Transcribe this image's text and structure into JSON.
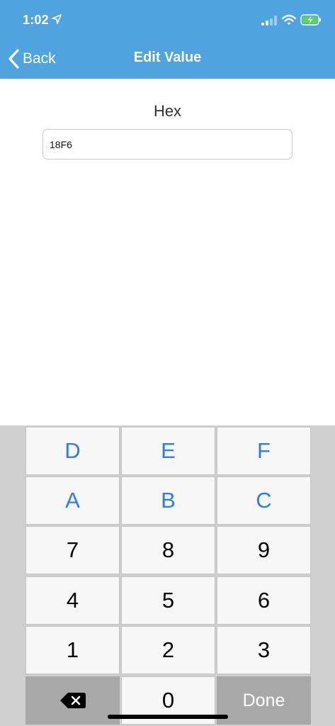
{
  "status_bar": {
    "time": "1:02",
    "icons": [
      "location-arrow-icon",
      "cellular-signal-icon",
      "wifi-icon",
      "battery-charging-icon"
    ]
  },
  "nav": {
    "back_label": "Back",
    "title": "Edit Value"
  },
  "field": {
    "label": "Hex",
    "value": "18F6"
  },
  "keypad": {
    "rows": [
      [
        "D",
        "E",
        "F"
      ],
      [
        "A",
        "B",
        "C"
      ],
      [
        "7",
        "8",
        "9"
      ],
      [
        "4",
        "5",
        "6"
      ],
      [
        "1",
        "2",
        "3"
      ]
    ],
    "zero": "0",
    "done_label": "Done",
    "delete_icon": "backspace-icon"
  },
  "colors": {
    "header_bg": "#4fa3de",
    "hex_key_text": "#2f7de6",
    "keypad_bg": "#cfcfcf",
    "dark_key_bg": "#a8a8a8"
  }
}
